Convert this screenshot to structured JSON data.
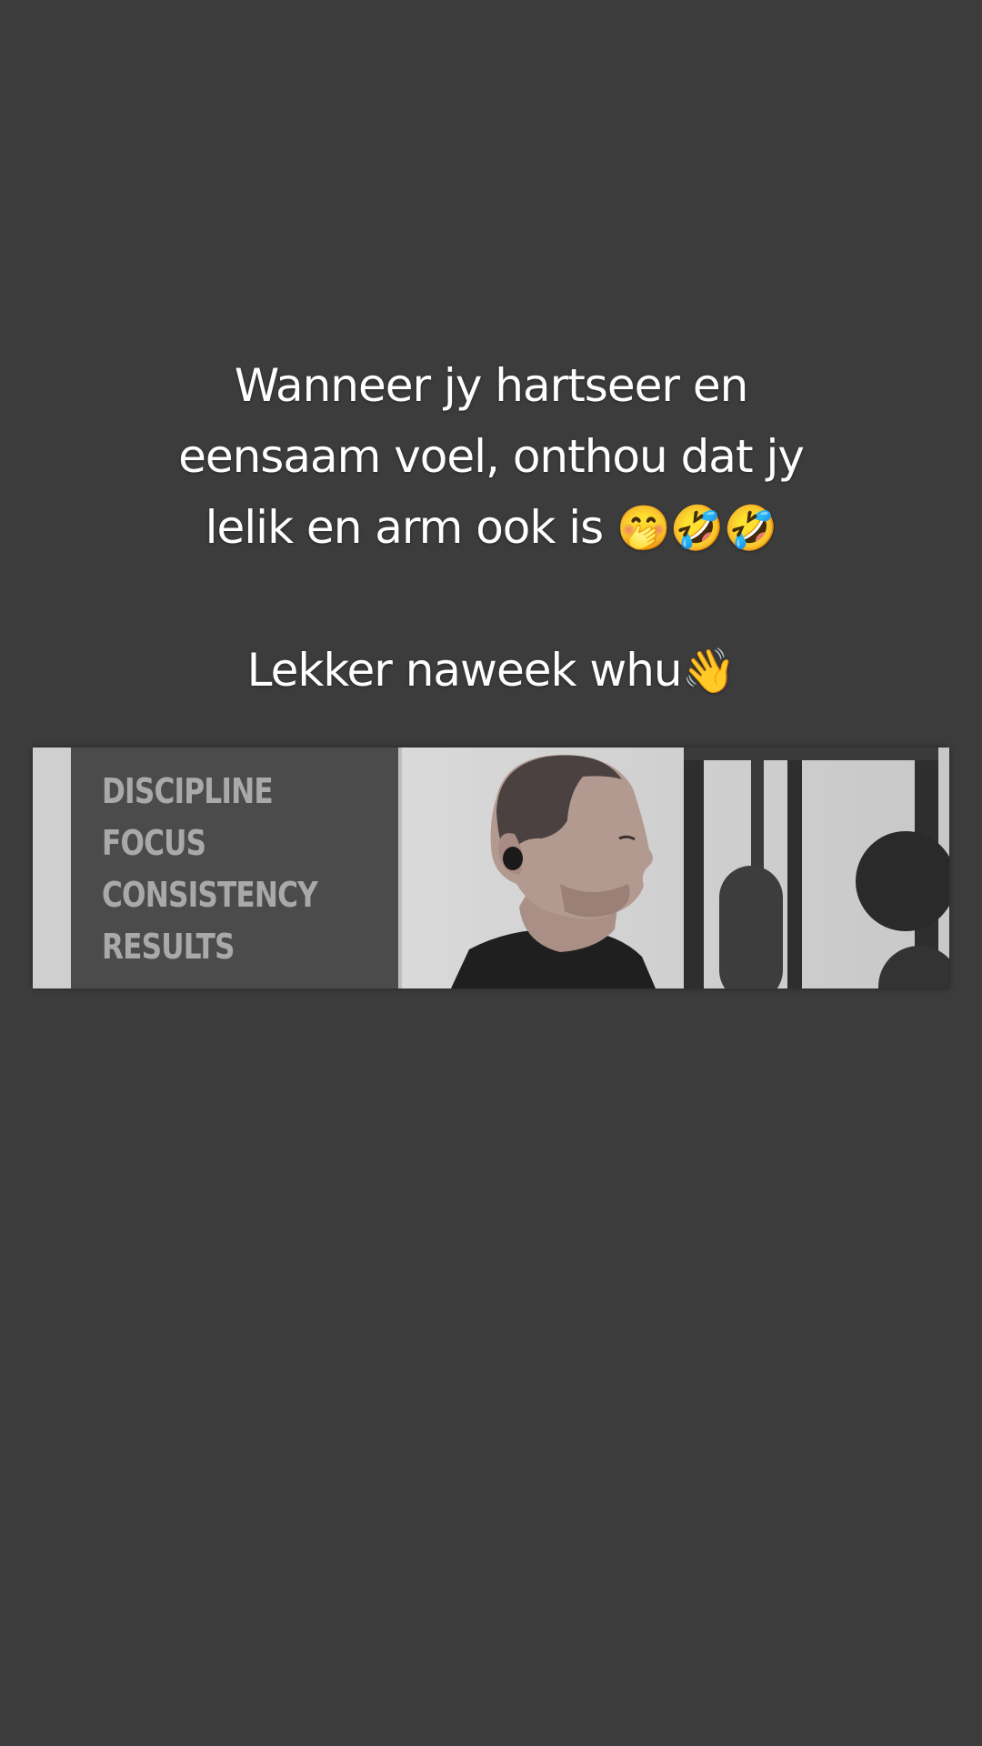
{
  "caption": {
    "line1": "Wanneer jy hartseer en",
    "line2": "eensaam voel, onthou dat jy",
    "line3_text": "lelik en arm ook is ",
    "line3_emoji": "🤭🤣🤣",
    "line4_text": "Lekker naweek whu",
    "line4_emoji": "👋"
  },
  "video": {
    "poster_words": [
      "DISCIPLINE",
      "FOCUS",
      "CONSISTENCY",
      "RESULTS"
    ]
  },
  "colors": {
    "background": "#3c3c3c",
    "caption_text": "#ffffff",
    "poster_bg": "#4b4b4b",
    "poster_text": "#a9a9a9"
  }
}
